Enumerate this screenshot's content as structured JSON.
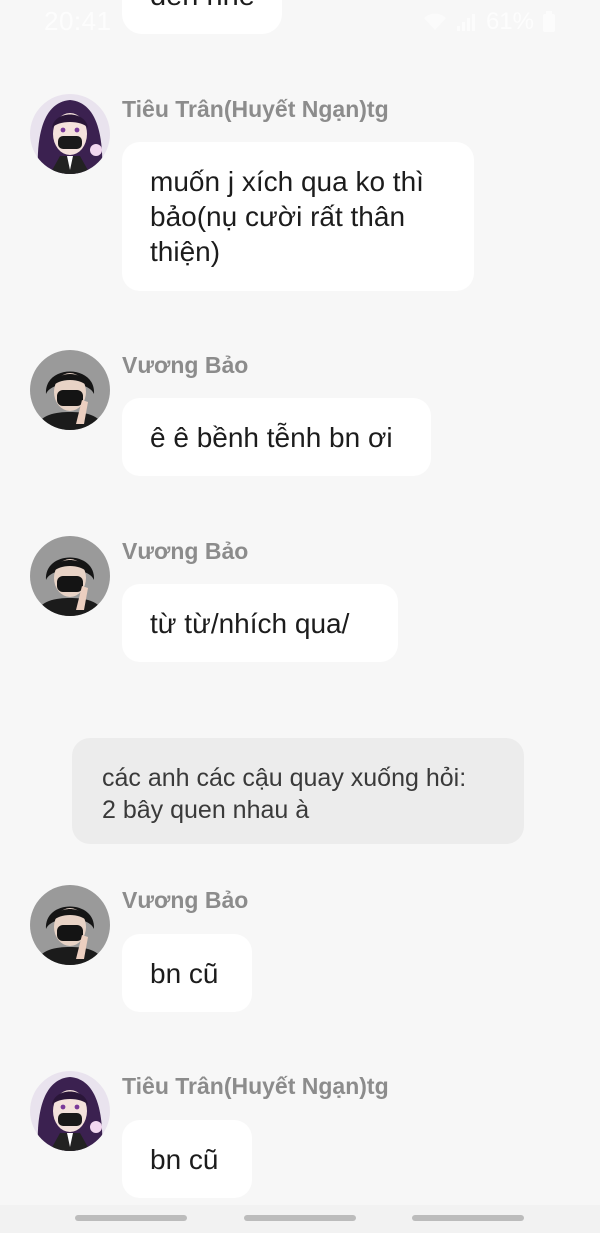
{
  "status_bar": {
    "time": "20:41",
    "battery": "61%",
    "icons": [
      "wifi-icon",
      "signal-icon",
      "battery-icon"
    ]
  },
  "partial_top_message": {
    "text": "đến nhé"
  },
  "messages": [
    {
      "sender": "Tiêu Trân(Huyết Ngạn)tg",
      "avatar": "purple-hair-girl-avatar",
      "lines": [
        "muốn j xích qua ko thì",
        "bảo(nụ cười rất thân",
        "thiện)"
      ]
    },
    {
      "sender": "Vương Bảo",
      "avatar": "masked-boy-avatar",
      "lines": [
        "ê ê bềnh tễnh bn ơi"
      ]
    },
    {
      "sender": "Vương Bảo",
      "avatar": "masked-boy-avatar",
      "lines": [
        "từ từ/nhích qua/"
      ]
    },
    {
      "sender": "Vương Bảo",
      "avatar": "masked-boy-avatar",
      "lines": [
        "bn cũ"
      ]
    },
    {
      "sender": "Tiêu Trân(Huyết Ngạn)tg",
      "avatar": "purple-hair-girl-avatar",
      "lines": [
        "bn cũ"
      ]
    }
  ],
  "narration": {
    "lines": [
      "các anh các cậu quay xuống hỏi:",
      "2 bây quen nhau à"
    ]
  },
  "colors": {
    "background": "#f7f7f7",
    "bubble": "#ffffff",
    "narration_bubble": "#ececec",
    "sender_name": "#8c8c8c",
    "text": "#1c1c1c"
  }
}
